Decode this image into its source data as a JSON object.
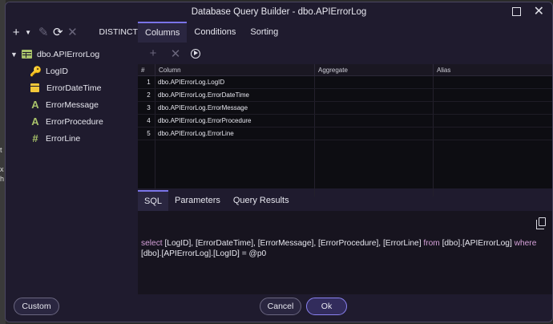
{
  "window": {
    "title": "Database Query Builder - dbo.APIErrorLog"
  },
  "toolbar": {
    "distinct_label": "DISTINCT"
  },
  "tabs_top": [
    "Columns",
    "Conditions",
    "Sorting"
  ],
  "tree": {
    "table": "dbo.APIErrorLog",
    "fields": [
      {
        "name": "LogID",
        "icon": "key-icon"
      },
      {
        "name": "ErrorDateTime",
        "icon": "calendar-icon"
      },
      {
        "name": "ErrorMessage",
        "icon": "text-a-icon"
      },
      {
        "name": "ErrorProcedure",
        "icon": "text-a-icon"
      },
      {
        "name": "ErrorLine",
        "icon": "hash-icon"
      }
    ]
  },
  "grid": {
    "headers": {
      "num": "#",
      "column": "Column",
      "aggregate": "Aggregate",
      "alias": "Alias"
    },
    "rows": [
      {
        "num": "1",
        "column": "dbo.APIErrorLog.LogID",
        "aggregate": "",
        "alias": ""
      },
      {
        "num": "2",
        "column": "dbo.APIErrorLog.ErrorDateTime",
        "aggregate": "",
        "alias": ""
      },
      {
        "num": "3",
        "column": "dbo.APIErrorLog.ErrorMessage",
        "aggregate": "",
        "alias": ""
      },
      {
        "num": "4",
        "column": "dbo.APIErrorLog.ErrorProcedure",
        "aggregate": "",
        "alias": ""
      },
      {
        "num": "5",
        "column": "dbo.APIErrorLog.ErrorLine",
        "aggregate": "",
        "alias": ""
      }
    ]
  },
  "tabs_bottom": [
    "SQL",
    "Parameters",
    "Query Results"
  ],
  "sql": {
    "kw_select": "select",
    "part1": " [LogID], [ErrorDateTime], [ErrorMessage], [ErrorProcedure], [ErrorLine] ",
    "kw_from": "from",
    "part2": " [dbo].[APIErrorLog] ",
    "kw_where": "where",
    "part3": " [dbo].[APIErrorLog].[LogID] = @p0"
  },
  "footer": {
    "custom_label": "Custom",
    "cancel_label": "Cancel",
    "ok_label": "Ok"
  },
  "colors": {
    "accent": "#7a74e8",
    "background": "#1f1b2e",
    "keyword": "#d4a0d8"
  }
}
